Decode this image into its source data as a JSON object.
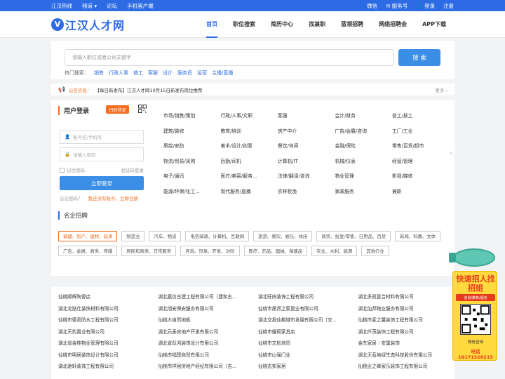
{
  "topbar": {
    "left": [
      "江汉热线",
      "频道 ▾",
      "论坛",
      "手机客户端"
    ],
    "right": {
      "wechat": "微信",
      "service": "服务号",
      "login": "登录",
      "register": "注册"
    }
  },
  "header": {
    "logo_letter": "V",
    "logo_text": "江汉人才网",
    "nav": [
      "首页",
      "职位搜索",
      "简历中心",
      "找兼职",
      "蓝领招聘",
      "网络招聘会",
      "APP下载"
    ],
    "active_nav": "首页"
  },
  "search": {
    "placeholder": "请输入职位或者公司关键字",
    "button": "搜 索",
    "hot_label": "热门搜索：",
    "hot_keywords": [
      "销售",
      "行政人事",
      "普工",
      "客服",
      "设计",
      "服务员",
      "运营",
      "主播/直播"
    ]
  },
  "notice": {
    "label": "公告信息：",
    "text": "【每日新发布】江汉人才网10月15日新发布岗位推荐",
    "more": "更多 ›"
  },
  "login": {
    "title": "用户登录",
    "scan_button": "扫码登录",
    "username_placeholder": "账号名/手机号",
    "password_placeholder": "请输入密码",
    "remember": "记住密码",
    "code_login": "验证码登录",
    "submit": "立即登录",
    "forgot": "忘记密码？",
    "register": "我还没有账号，立即注册"
  },
  "categories": [
    "市场/销售/策划",
    "行政/人事/文职",
    "客服",
    "会计/财务",
    "普工/技工",
    "建筑/装修",
    "教育/培训",
    "房产中介",
    "广告/会展/咨询",
    "工厂/工业",
    "质控/安防",
    "美术/设计/创意",
    "餐饮/休闲",
    "金融/保险",
    "零售/百货/超市",
    "物流/贸易/采购",
    "后勤/司机",
    "计算机/IT",
    "机械/仪表",
    "经营/管理",
    "电子/通讯",
    "医疗/美容/服务...",
    "法律/翻译/咨询",
    "物业管理",
    "影视/媒体",
    "能源/环保/化工...",
    "现代服务/直播",
    "农林牧渔",
    "家政服务",
    "兼职"
  ],
  "famous": {
    "title": "名企招聘",
    "tags": [
      "城建、房产、建材、装潢",
      "制造业",
      "汽车、物流",
      "电信邮政、计算机、互联网",
      "旅游、餐饮、娱乐、休闲",
      "商贸、批发/零售、日用品、百货",
      "新闻、科教、文体",
      "广告、会展、商务、传媒",
      "居民和商务、日常服务",
      "咨询、贸易、开发、对险",
      "医疗、药品、器械、保健品",
      "农业、水利、能源",
      "其他行业"
    ],
    "active_tag": 0
  },
  "companies": [
    "仙桃顺辉陶瓷店",
    "湖北嘉信古建工程有限公司（建和古...",
    "湖北旺府装饰工程有限公司",
    "湖北多凯复合材料有限公司",
    "湖北龙贴仕装饰材料有限公司",
    "湖北旭安保安服务有限公司",
    "仙桃市居然之家置业有限公司",
    "湖北仙邦物业服务有限公司",
    "仙桃市德高防水工程有限公司",
    "仙桃大自然地板",
    "湖北交投仙桃城市发展有限公司（交...",
    "仙桃市麦之馨装饰工程有限公司",
    "湖北天豹置业有限公司",
    "湖北元泰房地产开发有限公司",
    "仙桃市耀硕家具店",
    "湖北仟茂装饰工程有限公司",
    "湖北省金桂物业管理有限公司",
    "湖北省跃鸿装饰设计有限公司",
    "仙桃市文松商贸",
    "金东家居｜安巢装饰",
    "仙桃市明居装饰设计有限公司",
    "仙桃市福楚商贸有限公司",
    "仙桃市山强门业",
    "湖北天蓝地绿生态科技股份有限公司",
    "湖北驰轩装饰工程有限公司",
    "仙桃市祥居房地产经纪有限公司（吉...",
    "仙桃志邦家居",
    "仙桃业之峰家乐装饰工程有限公司"
  ],
  "float_ad": {
    "title": "快速招人找招姐",
    "subtitle": "咨询/推荐/服务",
    "wechat": "微信咨询",
    "tel": "电话 18171328215"
  }
}
